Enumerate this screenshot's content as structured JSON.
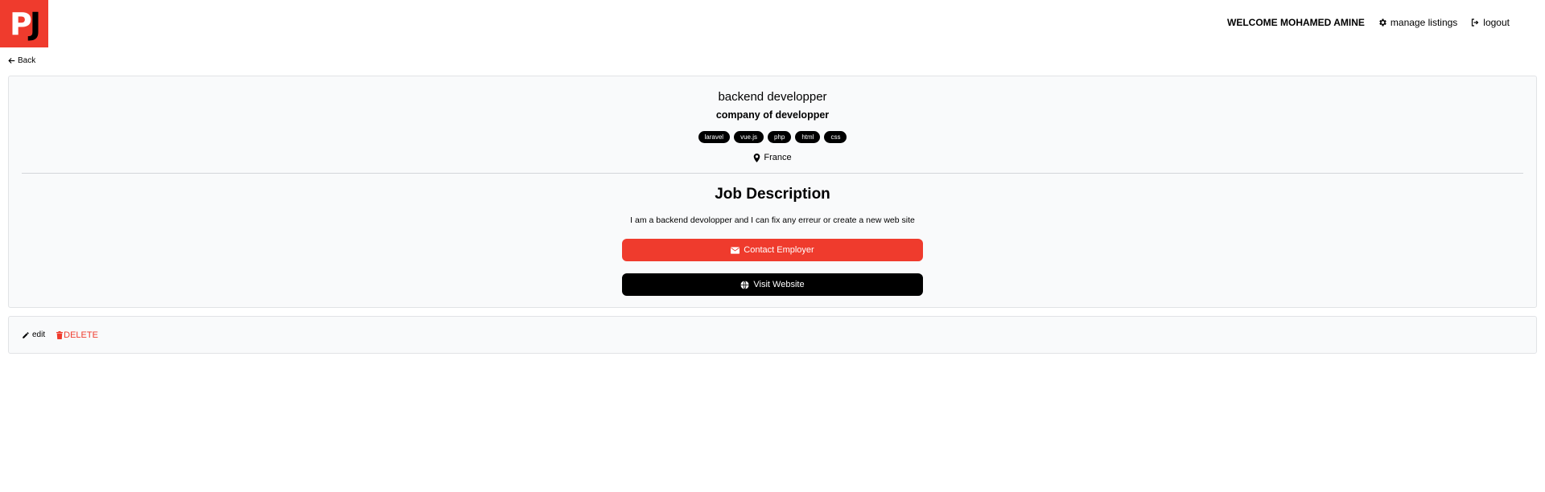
{
  "brand": {
    "logo_p": "P",
    "logo_j": "J",
    "accent": "#ef3b2d"
  },
  "header": {
    "welcome": "WELCOME MOHAMED AMINE",
    "manage_listings": "manage listings",
    "logout": "logout"
  },
  "back_label": "Back",
  "listing": {
    "title": "backend developper",
    "company": "company of developper",
    "tags": [
      "laravel",
      "vue.js",
      "php",
      "html",
      "css"
    ],
    "location": "France",
    "description_heading": "Job Description",
    "description": "I am a backend devolopper and I can fix any erreur or create a new web site",
    "contact_label": "Contact Employer",
    "website_label": "Visit Website"
  },
  "actions": {
    "edit_label": "edit",
    "delete_label": "DELETE"
  },
  "icons": {
    "settings": "gear-icon",
    "logout": "logout-icon",
    "back": "arrow-left-icon",
    "location": "location-pin-icon",
    "contact": "envelope-icon",
    "website": "globe-icon",
    "edit": "pencil-icon",
    "delete": "trash-icon"
  }
}
